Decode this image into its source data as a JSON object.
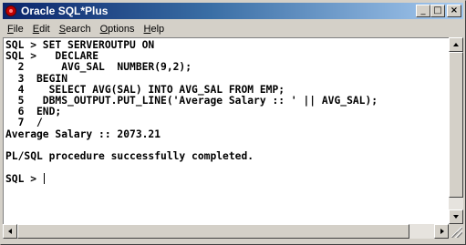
{
  "window": {
    "title": "Oracle SQL*Plus",
    "buttons": {
      "minimize": "_",
      "maximize": "□",
      "close": "×"
    }
  },
  "menu": [
    {
      "label": "File",
      "mnemonic": "F",
      "rest": "ile"
    },
    {
      "label": "Edit",
      "mnemonic": "E",
      "rest": "dit"
    },
    {
      "label": "Search",
      "mnemonic": "S",
      "rest": "earch"
    },
    {
      "label": "Options",
      "mnemonic": "O",
      "rest": "ptions"
    },
    {
      "label": "Help",
      "mnemonic": "H",
      "rest": "elp"
    }
  ],
  "console": {
    "lines": [
      "SQL > SET SERVEROUTPU ON",
      "SQL >   DECLARE",
      "  2      AVG_SAL  NUMBER(9,2);",
      "  3  BEGIN",
      "  4    SELECT AVG(SAL) INTO AVG_SAL FROM EMP;",
      "  5   DBMS_OUTPUT.PUT_LINE('Average Salary :: ' || AVG_SAL);",
      "  6  END;",
      "  7  /",
      "Average Salary :: 2073.21",
      "",
      "PL/SQL procedure successfully completed.",
      "",
      "SQL > "
    ]
  },
  "colors": {
    "title_gradient_start": "#0a246a",
    "title_gradient_end": "#a6caf0",
    "console_background": "#ffffff",
    "chrome": "#d4d0c8"
  },
  "icons": {
    "app": "oracle-icon",
    "scroll_up": "arrow-up-icon",
    "scroll_down": "arrow-down-icon",
    "scroll_left": "arrow-left-icon",
    "scroll_right": "arrow-right-icon"
  }
}
